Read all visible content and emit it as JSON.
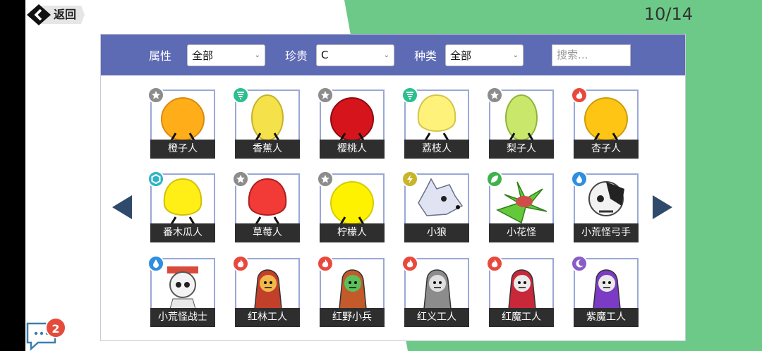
{
  "header": {
    "back_label": "返回",
    "page_counter": "10/14"
  },
  "filters": {
    "attr_label": "属性",
    "attr_value": "全部",
    "rarity_label": "珍贵",
    "rarity_value": "C",
    "type_label": "种类",
    "type_value": "全部",
    "search_placeholder": "搜索..."
  },
  "colors": {
    "filter_bar": "#5d6ab4",
    "green_bg": "#6cc987",
    "card_border": "#9aa8d6",
    "badge_star": "#8c8c8c",
    "badge_wind": "#2bbf8e",
    "badge_fire": "#e8493c",
    "badge_earth": "#2fb4c4",
    "badge_thunder": "#c9b52a",
    "badge_leaf": "#3fb24e",
    "badge_water": "#2f8ee0",
    "badge_dark": "#8a5cc8"
  },
  "cards": [
    {
      "name": "橙子人",
      "element": "star-icon"
    },
    {
      "name": "香蕉人",
      "element": "wind-icon"
    },
    {
      "name": "樱桃人",
      "element": "star-icon"
    },
    {
      "name": "荔枝人",
      "element": "wind-icon"
    },
    {
      "name": "梨子人",
      "element": "star-icon"
    },
    {
      "name": "杏子人",
      "element": "fire-icon"
    },
    {
      "name": "番木瓜人",
      "element": "earth-icon"
    },
    {
      "name": "草莓人",
      "element": "star-icon"
    },
    {
      "name": "柠檬人",
      "element": "star-icon"
    },
    {
      "name": "小狼",
      "element": "thunder-icon"
    },
    {
      "name": "小花怪",
      "element": "leaf-icon"
    },
    {
      "name": "小荒怪弓手",
      "element": "water-icon"
    },
    {
      "name": "小荒怪战士",
      "element": "water-icon"
    },
    {
      "name": "红林工人",
      "element": "fire-icon"
    },
    {
      "name": "红野小兵",
      "element": "fire-icon"
    },
    {
      "name": "红义工人",
      "element": "fire-icon"
    },
    {
      "name": "红魔工人",
      "element": "fire-icon"
    },
    {
      "name": "紫魔工人",
      "element": "dark-icon"
    }
  ],
  "chat": {
    "notification_count": "2"
  }
}
